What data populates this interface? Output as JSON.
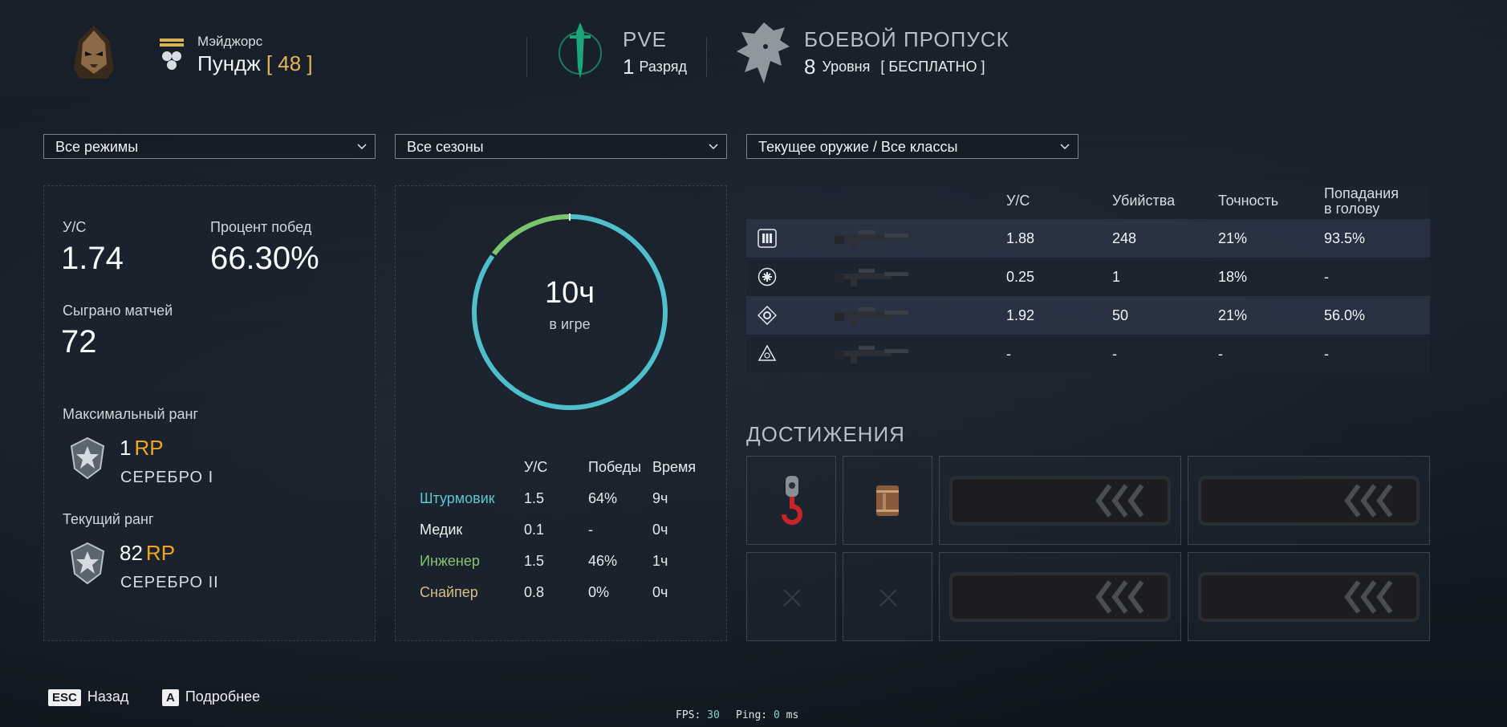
{
  "profile": {
    "nickname_small": "Мэйджорс",
    "nickname": "Пундж",
    "level": "[ 48 ]"
  },
  "pve": {
    "title": "PVE",
    "value": "1",
    "unit": "Разряд"
  },
  "battle_pass": {
    "title": "БОЕВОЙ ПРОПУСК",
    "value": "8",
    "unit": "Уровня",
    "tag": "[ БЕСПЛАТНО ]"
  },
  "filters": {
    "mode": "Все режимы",
    "season": "Все сезоны",
    "weapon": "Текущее оружие / Все классы"
  },
  "summary": {
    "kd_label": "У/С",
    "kd_value": "1.74",
    "win_label": "Процент побед",
    "win_value": "66.30%",
    "matches_label": "Сыграно матчей",
    "matches_value": "72",
    "max_rank_label": "Максимальный ранг",
    "max_rank_value": "1",
    "max_rank_unit": "RP",
    "max_rank_name": "СЕРЕБРО I",
    "cur_rank_label": "Текущий ранг",
    "cur_rank_value": "82",
    "cur_rank_unit": "RP",
    "cur_rank_name": "СЕРЕБРО II"
  },
  "playtime": {
    "value": "10ч",
    "caption": "в игре",
    "ring_color": "#4fbfcc",
    "accent_color": "#7cc46a"
  },
  "class_table": {
    "headers": [
      "У/С",
      "Победы",
      "Время"
    ],
    "rows": [
      {
        "name": "Штурмовик",
        "kd": "1.5",
        "wins": "64%",
        "time": "9ч",
        "color": "#5cc6d0"
      },
      {
        "name": "Медик",
        "kd": "0.1",
        "wins": "-",
        "time": "0ч",
        "color": "#eef0f2"
      },
      {
        "name": "Инженер",
        "kd": "1.5",
        "wins": "46%",
        "time": "1ч",
        "color": "#84c46f"
      },
      {
        "name": "Снайпер",
        "kd": "0.8",
        "wins": "0%",
        "time": "0ч",
        "color": "#d8bd86"
      }
    ]
  },
  "weapon_table": {
    "headers": [
      "У/С",
      "Убийства",
      "Точность",
      "Попадания",
      "в голову"
    ],
    "rows": [
      {
        "class_icon": "ammo-icon",
        "kd": "1.88",
        "kills": "248",
        "acc": "21%",
        "hs": "93.5%"
      },
      {
        "class_icon": "medic-icon",
        "kd": "0.25",
        "kills": "1",
        "acc": "18%",
        "hs": "-"
      },
      {
        "class_icon": "engineer-icon",
        "kd": "1.92",
        "kills": "50",
        "acc": "21%",
        "hs": "56.0%"
      },
      {
        "class_icon": "sniper-icon",
        "kd": "-",
        "kills": "-",
        "acc": "-",
        "hs": "-"
      }
    ]
  },
  "achievements": {
    "title": "ДОСТИЖЕНИЯ"
  },
  "footer": {
    "back_key": "ESC",
    "back_label": "Назад",
    "more_key": "A",
    "more_label": "Подробнее",
    "fps_label": "FPS:",
    "fps_value": "30",
    "ping_label": "Ping:",
    "ping_value": "0",
    "ping_unit": "ms"
  }
}
